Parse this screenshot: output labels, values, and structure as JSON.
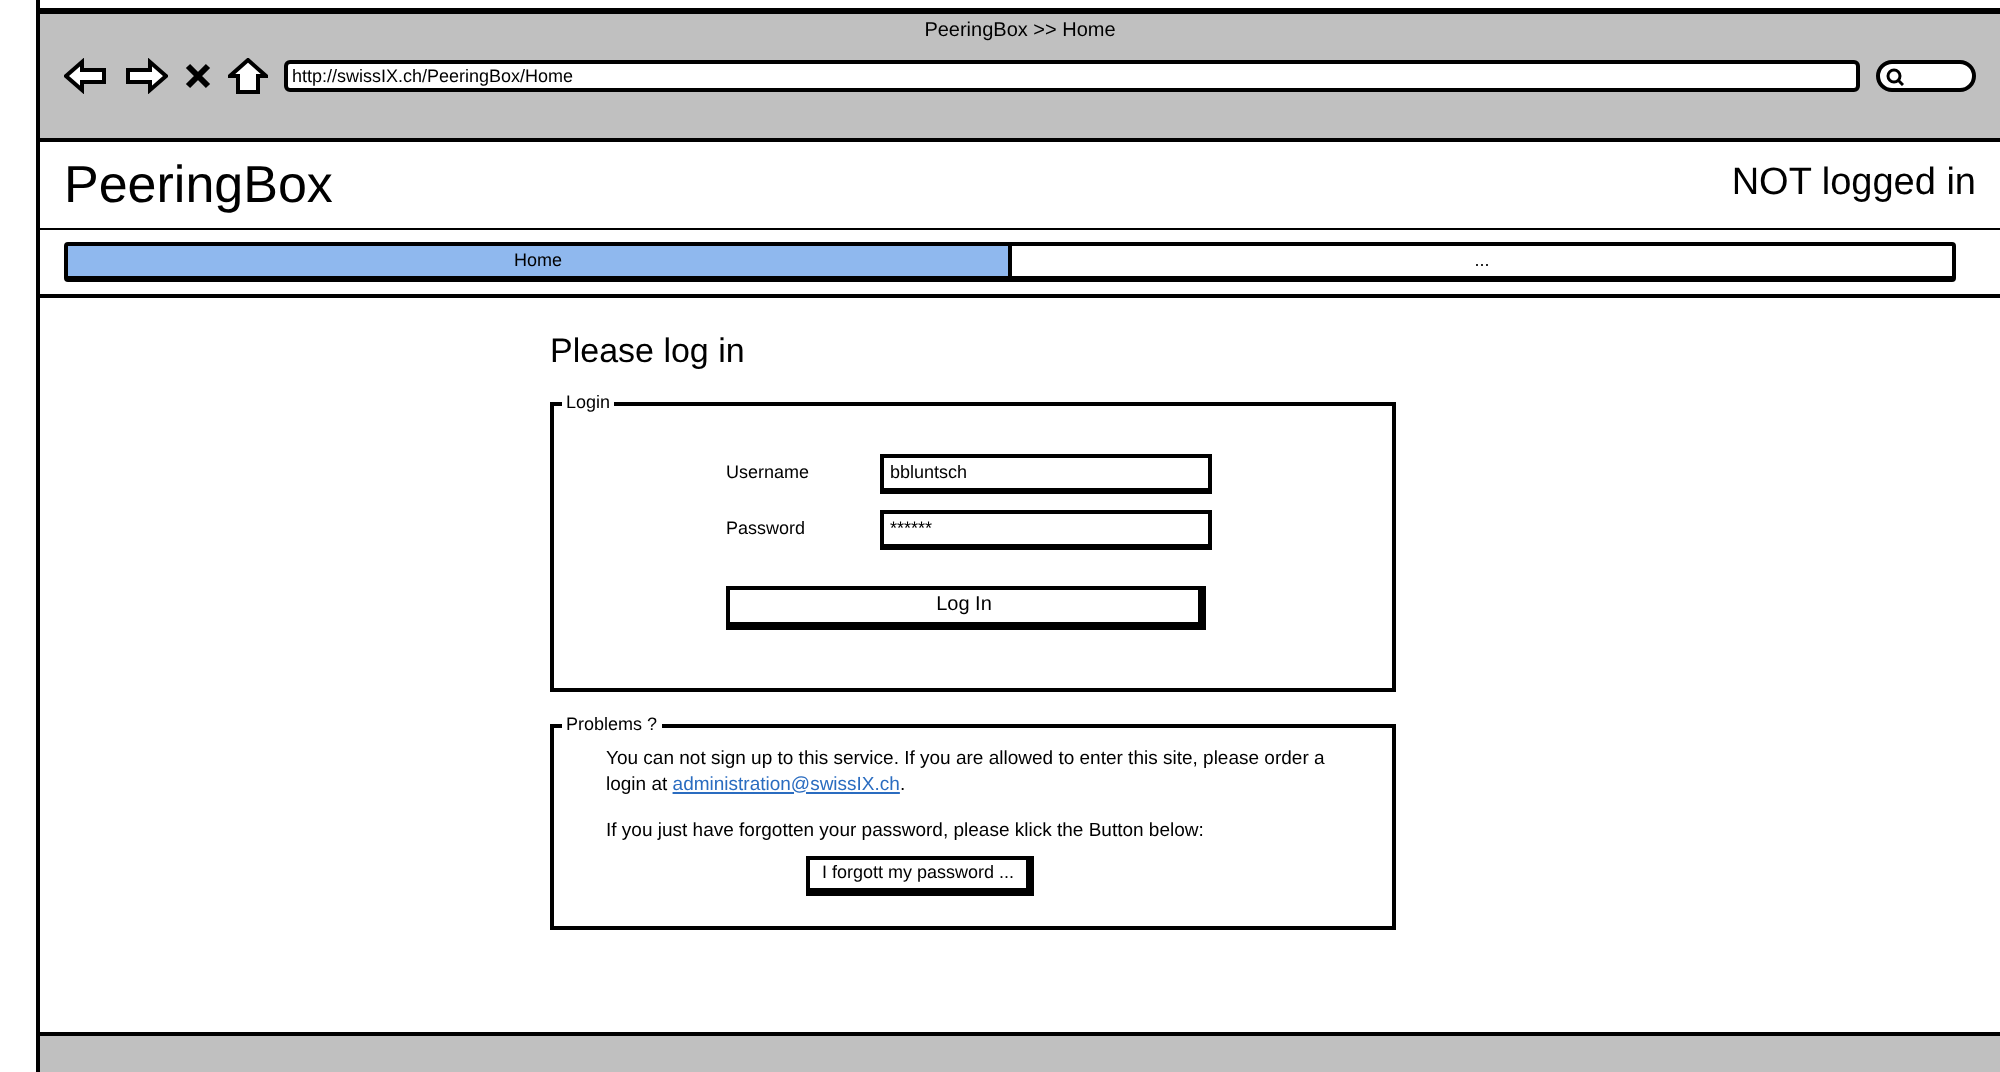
{
  "window": {
    "title": "PeeringBox >> Home"
  },
  "browser": {
    "url": "http://swissIX.ch/PeeringBox/Home"
  },
  "header": {
    "logo": "PeeringBox",
    "login_status": "NOT logged in"
  },
  "tabs": [
    {
      "label": "Home",
      "selected": true
    },
    {
      "label": "...",
      "selected": false
    }
  ],
  "page": {
    "heading": "Please log in"
  },
  "login": {
    "legend": "Login",
    "fields": [
      {
        "label": "Username",
        "value": "bbluntsch"
      },
      {
        "label": "Password",
        "value": "******"
      }
    ],
    "button": "Log In"
  },
  "problems": {
    "legend": "Problems ?",
    "text": "You can not sign up to this service. If you are allowed to enter this site, please order a login at ",
    "link": "administration@swissIX.ch",
    "text_after": ".",
    "hint": "If you just have forgotten your password, please klick the Button below:",
    "button": "I forgott my password ..."
  }
}
